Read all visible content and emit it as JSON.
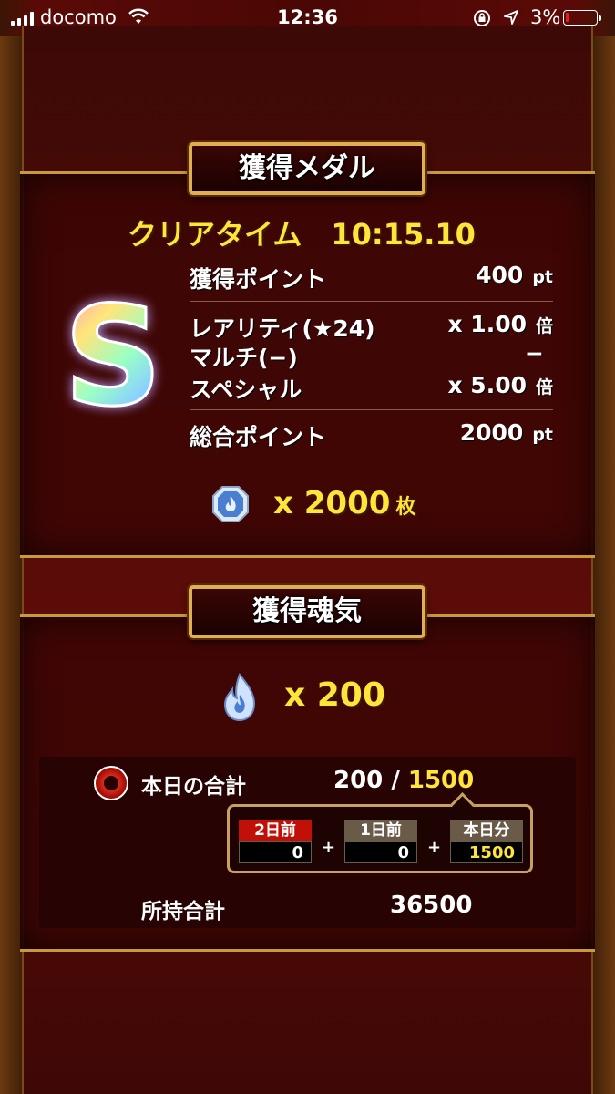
{
  "status_bar": {
    "carrier": "docomo",
    "time": "12:36",
    "battery_percent": "3%",
    "battery_level": 0.03,
    "icons": [
      "signal-icon",
      "wifi-icon",
      "orientation-lock-icon",
      "location-icon",
      "battery-icon"
    ]
  },
  "medal_section": {
    "title": "獲得メダル",
    "clear_time_label": "クリアタイム",
    "clear_time": "10:15.10",
    "rank": "S",
    "rows": [
      {
        "label": "獲得ポイント",
        "value": "400",
        "unit": "pt"
      },
      {
        "label": "レアリティ(★24)",
        "value": "x 1.00",
        "unit": "倍"
      },
      {
        "label": "マルチ(−)",
        "value": "−",
        "unit": ""
      },
      {
        "label": "スペシャル",
        "value": "x 5.00",
        "unit": "倍"
      },
      {
        "label": "総合ポイント",
        "value": "2000",
        "unit": "pt"
      }
    ],
    "medal_count": "x 2000",
    "medal_unit": "枚",
    "medal_icon": "medal-icon"
  },
  "soul_section": {
    "title": "獲得魂気",
    "soul_count": "x 200",
    "soul_icon": "soul-flame-icon",
    "today_label": "本日の合計",
    "today_value": "200 / ",
    "today_cap": "1500",
    "breakdown": [
      {
        "label": "2日前",
        "value": "0"
      },
      {
        "label": "1日前",
        "value": "0"
      },
      {
        "label": "本日分",
        "value": "1500"
      }
    ],
    "plus": "+",
    "total_label": "所持合計",
    "total_value": "36500"
  },
  "colors": {
    "accent_yellow": "#ffe53a",
    "frame_gold": "#c89a3a",
    "bg_red": "#520b07"
  }
}
